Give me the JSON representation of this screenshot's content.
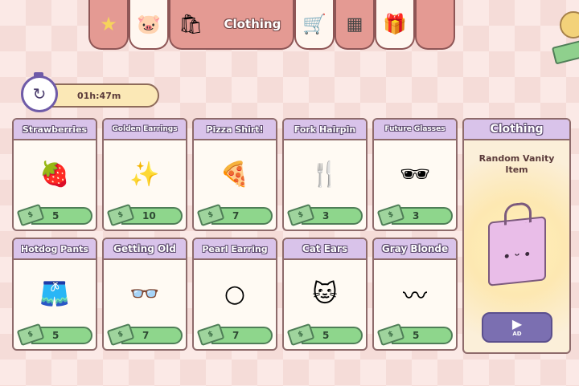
{
  "tabs": [
    {
      "icon": "star-icon",
      "glyph": "★",
      "style": "dark"
    },
    {
      "icon": "piggy-bank-icon",
      "glyph": "🐷",
      "style": "light"
    },
    {
      "icon": "shopping-bag-icon",
      "glyph": "🛍",
      "style": "active",
      "label": "Clothing"
    },
    {
      "icon": "shopping-cart-icon",
      "glyph": "🛒",
      "style": "light"
    },
    {
      "icon": "checker-rug-icon",
      "glyph": "▦",
      "style": "dark"
    },
    {
      "icon": "gift-box-icon",
      "glyph": "🎁",
      "style": "light"
    },
    {
      "icon": "",
      "glyph": "",
      "style": "dark"
    }
  ],
  "timer": {
    "value": "01h:47m"
  },
  "colors": {
    "price_green": "#8ed68c",
    "header_lavender": "#d9c3ea",
    "tab_pink": "#e49a93"
  },
  "items": [
    {
      "name": "Strawberries",
      "price": "5",
      "icon": "strawberry-hat-icon",
      "glyph": "🍓"
    },
    {
      "name": "Golden Earrings",
      "price": "10",
      "icon": "golden-earrings-icon",
      "glyph": "✨"
    },
    {
      "name": "Pizza Shirt!",
      "price": "7",
      "icon": "pizza-shirt-icon",
      "glyph": "🍕"
    },
    {
      "name": "Fork Hairpin",
      "price": "3",
      "icon": "fork-hairpin-icon",
      "glyph": "🍴"
    },
    {
      "name": "Future Glasses",
      "price": "3",
      "icon": "future-glasses-icon",
      "glyph": "🕶"
    },
    {
      "name": "Hotdog Pants",
      "price": "5",
      "icon": "hotdog-pants-icon",
      "glyph": "🩳"
    },
    {
      "name": "Getting Old",
      "price": "7",
      "icon": "glasses-mustache-icon",
      "glyph": "👓"
    },
    {
      "name": "Pearl Earring",
      "price": "7",
      "icon": "pearl-earring-icon",
      "glyph": "○"
    },
    {
      "name": "Cat Ears",
      "price": "5",
      "icon": "cat-ears-icon",
      "glyph": "🐱"
    },
    {
      "name": "Gray Blonde",
      "price": "5",
      "icon": "hair-icon",
      "glyph": "〰"
    }
  ],
  "featured": {
    "title": "Clothing",
    "subtitle": "Random Vanity Item",
    "ad_label": "AD",
    "face": "• ᵕ •"
  }
}
